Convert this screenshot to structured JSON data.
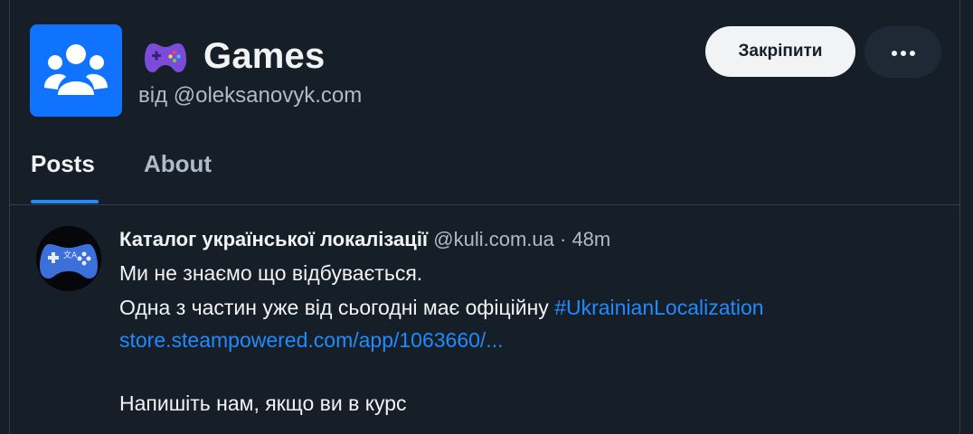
{
  "feed": {
    "emoji_icon": "gamepad-icon",
    "title": "Games",
    "byline": "від @oleksanovyk.com"
  },
  "actions": {
    "pin_label": "Закріпити",
    "more_icon": "ellipsis-icon"
  },
  "tabs": [
    {
      "label": "Posts",
      "active": true
    },
    {
      "label": "About",
      "active": false
    }
  ],
  "post": {
    "author_name": "Каталог української локалізації",
    "author_handle": "@kuli.com.ua",
    "separator": "·",
    "time": "48m",
    "lines": [
      "Ми не знаємо що відбувається.",
      "Одна з частин уже від сьогодні має офіційну"
    ],
    "hashtag": "#UkrainianLocalization",
    "link": "store.steampowered.com/app/1063660/...",
    "closing": "Напишіть нам, якщо ви в курс"
  },
  "colors": {
    "background": "#161e27",
    "accent": "#208bfe",
    "feed_avatar": "#0f73ff",
    "muted_text": "#aebbc9"
  }
}
